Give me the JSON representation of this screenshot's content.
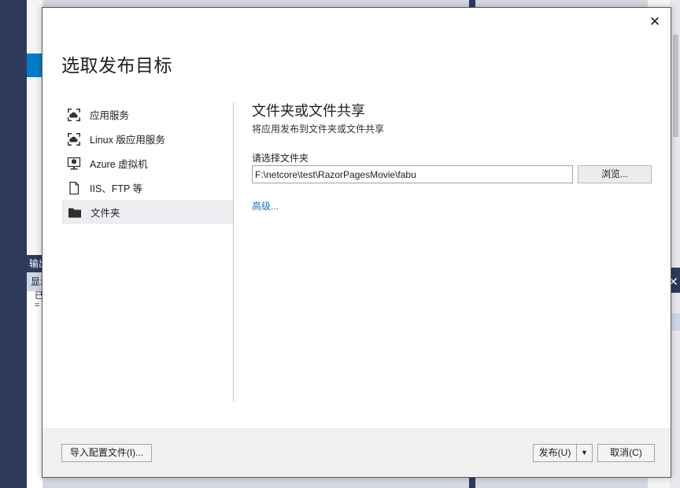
{
  "background": {
    "output_title": "输出",
    "output_toolbar_text": "显示",
    "output_body_line1": "已",
    "output_body_line2": "="
  },
  "dialog": {
    "title": "选取发布目标",
    "close_glyph": "✕",
    "nav": {
      "items": [
        {
          "label": "应用服务",
          "icon": "app-service-icon"
        },
        {
          "label": "Linux 版应用服务",
          "icon": "app-service-linux-icon"
        },
        {
          "label": "Azure 虚拟机",
          "icon": "virtual-machine-icon"
        },
        {
          "label": "IIS、FTP 等",
          "icon": "document-icon"
        },
        {
          "label": "文件夹",
          "icon": "folder-icon",
          "selected": true
        }
      ]
    },
    "content": {
      "heading": "文件夹或文件共享",
      "subheading": "将应用发布到文件夹或文件共享",
      "folder_label": "请选择文件夹",
      "folder_path": "F:\\netcore\\test\\RazorPagesMovie\\fabu",
      "browse_label": "浏览...",
      "advanced_link": "高级..."
    },
    "footer": {
      "import_label": "导入配置文件(I)...",
      "publish_label": "发布(U)",
      "publish_dropdown_glyph": "▼",
      "cancel_label": "取消(C)"
    }
  },
  "colors": {
    "link": "#1e6fc4",
    "ide_dark": "#2d3a5c",
    "accent": "#007acc"
  }
}
